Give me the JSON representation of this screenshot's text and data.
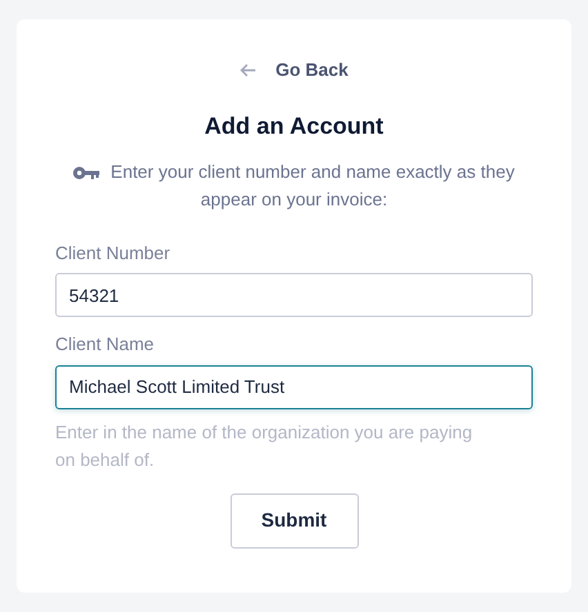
{
  "back_link": {
    "label": "Go Back"
  },
  "title": "Add an Account",
  "instructions": "Enter your client number and name exactly as they appear on your invoice:",
  "fields": [
    {
      "label": "Client Number",
      "value": "54321",
      "focused": false
    },
    {
      "label": "Client Name",
      "value": "Michael Scott Limited Trust",
      "focused": true,
      "help": "Enter in the name of the organization you are paying on behalf of."
    }
  ],
  "submit_button": {
    "label": "Submit"
  }
}
